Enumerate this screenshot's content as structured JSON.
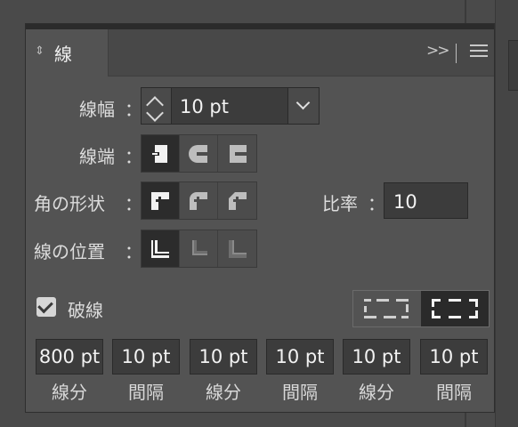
{
  "panel": {
    "title": "線",
    "icons": {
      "tab_arrows": "updown-arrows-icon",
      "expand": "double-chevron-right-icon",
      "menu": "hamburger-menu-icon"
    }
  },
  "weight": {
    "label": "線幅",
    "colon": "：",
    "value": "10 pt",
    "icons": [
      "stepper-icon",
      "chevron-down-icon"
    ]
  },
  "cap": {
    "label": "線端",
    "colon": "：",
    "options": [
      "butt-cap-icon",
      "round-cap-icon",
      "projecting-cap-icon"
    ],
    "selected_index": 0
  },
  "corner": {
    "label": "角の形状",
    "colon": "：",
    "options": [
      "miter-join-icon",
      "round-join-icon",
      "bevel-join-icon"
    ],
    "selected_index": 0
  },
  "limit": {
    "label": "比率",
    "colon": "：",
    "value": "10"
  },
  "align": {
    "label": "線の位置",
    "colon": "：",
    "options": [
      "align-center-icon",
      "align-inside-icon",
      "align-outside-icon"
    ],
    "selected_index": 0
  },
  "dashed": {
    "label": "破線",
    "checked": true,
    "modes": [
      "preserve-dash-icon",
      "align-dash-corners-icon"
    ],
    "selected_mode": 1,
    "fields": [
      {
        "value": "800 pt",
        "label": "線分"
      },
      {
        "value": "10 pt",
        "label": "間隔"
      },
      {
        "value": "10 pt",
        "label": "線分"
      },
      {
        "value": "10 pt",
        "label": "間隔"
      },
      {
        "value": "10 pt",
        "label": "線分"
      },
      {
        "value": "10 pt",
        "label": "間隔"
      }
    ]
  },
  "colors": {
    "panel_bg": "#535353",
    "field_bg": "#3c3c3c",
    "selected_bg": "#2c2c2c",
    "text": "#dcdcdc"
  }
}
